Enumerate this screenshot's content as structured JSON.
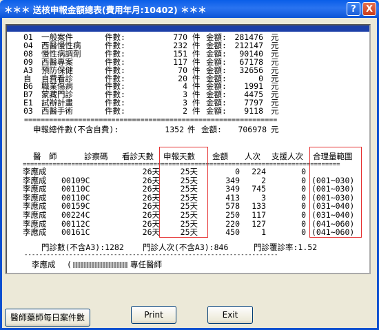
{
  "window": {
    "title": "＊＊＊ 送核申報金額總表(費用年月:10402) ＊＊＊",
    "help": "?",
    "close": "X"
  },
  "summary": [
    {
      "code": "01",
      "name": "一般案件",
      "cnt_label": "件數:",
      "cnt": "770",
      "unit": "件",
      "amt_label": "金額:",
      "amt": "281476",
      "cur": "元"
    },
    {
      "code": "04",
      "name": "西醫慢性病",
      "cnt_label": "件數:",
      "cnt": "232",
      "unit": "件",
      "amt_label": "金額:",
      "amt": "212147",
      "cur": "元"
    },
    {
      "code": "08",
      "name": "慢性病調劑",
      "cnt_label": "件數:",
      "cnt": "151",
      "unit": "件",
      "amt_label": "金額:",
      "amt": "90140",
      "cur": "元"
    },
    {
      "code": "09",
      "name": "西醫專案",
      "cnt_label": "件數:",
      "cnt": "117",
      "unit": "件",
      "amt_label": "金額:",
      "amt": "67178",
      "cur": "元"
    },
    {
      "code": "A3",
      "name": "預防保健",
      "cnt_label": "件數:",
      "cnt": "70",
      "unit": "件",
      "amt_label": "金額:",
      "amt": "32656",
      "cur": "元"
    },
    {
      "code": "自",
      "name": "自費看診",
      "cnt_label": "件數:",
      "cnt": "20",
      "unit": "件",
      "amt_label": "金額:",
      "amt": "0",
      "cur": "元"
    },
    {
      "code": "B6",
      "name": "職業傷病",
      "cnt_label": "件數:",
      "cnt": "4",
      "unit": "件",
      "amt_label": "金額:",
      "amt": "1991",
      "cur": "元"
    },
    {
      "code": "B7",
      "name": "蒙藏門診",
      "cnt_label": "件數:",
      "cnt": "3",
      "unit": "件",
      "amt_label": "金額:",
      "amt": "4475",
      "cur": "元"
    },
    {
      "code": "E1",
      "name": "試辦計畫",
      "cnt_label": "件數:",
      "cnt": "3",
      "unit": "件",
      "amt_label": "金額:",
      "amt": "7797",
      "cur": "元"
    },
    {
      "code": "03",
      "name": "西醫手術",
      "cnt_label": "件數:",
      "cnt": "2",
      "unit": "件",
      "amt_label": "金額:",
      "amt": "9118",
      "cur": "元"
    }
  ],
  "total": {
    "label": "申報總件數(不含自費):",
    "cnt": "1352",
    "unit": "件",
    "amt_label": "金額:",
    "amt": "706978",
    "cur": "元"
  },
  "table": {
    "headers": [
      "醫　師",
      "診察碼",
      "看診天數",
      "申報天數",
      "金額",
      "人次",
      "支援人次",
      "合理量範圍"
    ],
    "rows": [
      {
        "doctor": "李應成",
        "code": "",
        "days": "26天",
        "declared": "25天",
        "amount": "0",
        "visits": "224",
        "support": "0",
        "range": ""
      },
      {
        "doctor": "李應成",
        "code": "00109C",
        "days": "26天",
        "declared": "25天",
        "amount": "349",
        "visits": "2",
        "support": "0",
        "range": "(001~030)"
      },
      {
        "doctor": "李應成",
        "code": "00110C",
        "days": "26天",
        "declared": "25天",
        "amount": "349",
        "visits": "745",
        "support": "0",
        "range": "(001~030)"
      },
      {
        "doctor": "李應成",
        "code": "00110C",
        "days": "26天",
        "declared": "25天",
        "amount": "413",
        "visits": "3",
        "support": "0",
        "range": "(001~030)"
      },
      {
        "doctor": "李應成",
        "code": "00159C",
        "days": "26天",
        "declared": "25天",
        "amount": "578",
        "visits": "133",
        "support": "0",
        "range": "(031~040)"
      },
      {
        "doctor": "李應成",
        "code": "00224C",
        "days": "26天",
        "declared": "25天",
        "amount": "250",
        "visits": "117",
        "support": "0",
        "range": "(031~040)"
      },
      {
        "doctor": "李應成",
        "code": "00112C",
        "days": "26天",
        "declared": "25天",
        "amount": "220",
        "visits": "127",
        "support": "0",
        "range": "(041~060)"
      },
      {
        "doctor": "李應成",
        "code": "00161C",
        "days": "26天",
        "declared": "25天",
        "amount": "450",
        "visits": "1",
        "support": "0",
        "range": "(041~060)"
      }
    ]
  },
  "stats": {
    "visits_label": "門診數(不含A3):1282",
    "persons_label": "門診人次(不含A3):846",
    "rate_label": "門診覆診率:1.52"
  },
  "doctor_footer": {
    "name": "李應成",
    "paren": "(",
    "role": "專任醫師"
  },
  "buttons": {
    "daily": "醫師藥師每日案件數",
    "print": "Print",
    "exit": "Exit"
  }
}
